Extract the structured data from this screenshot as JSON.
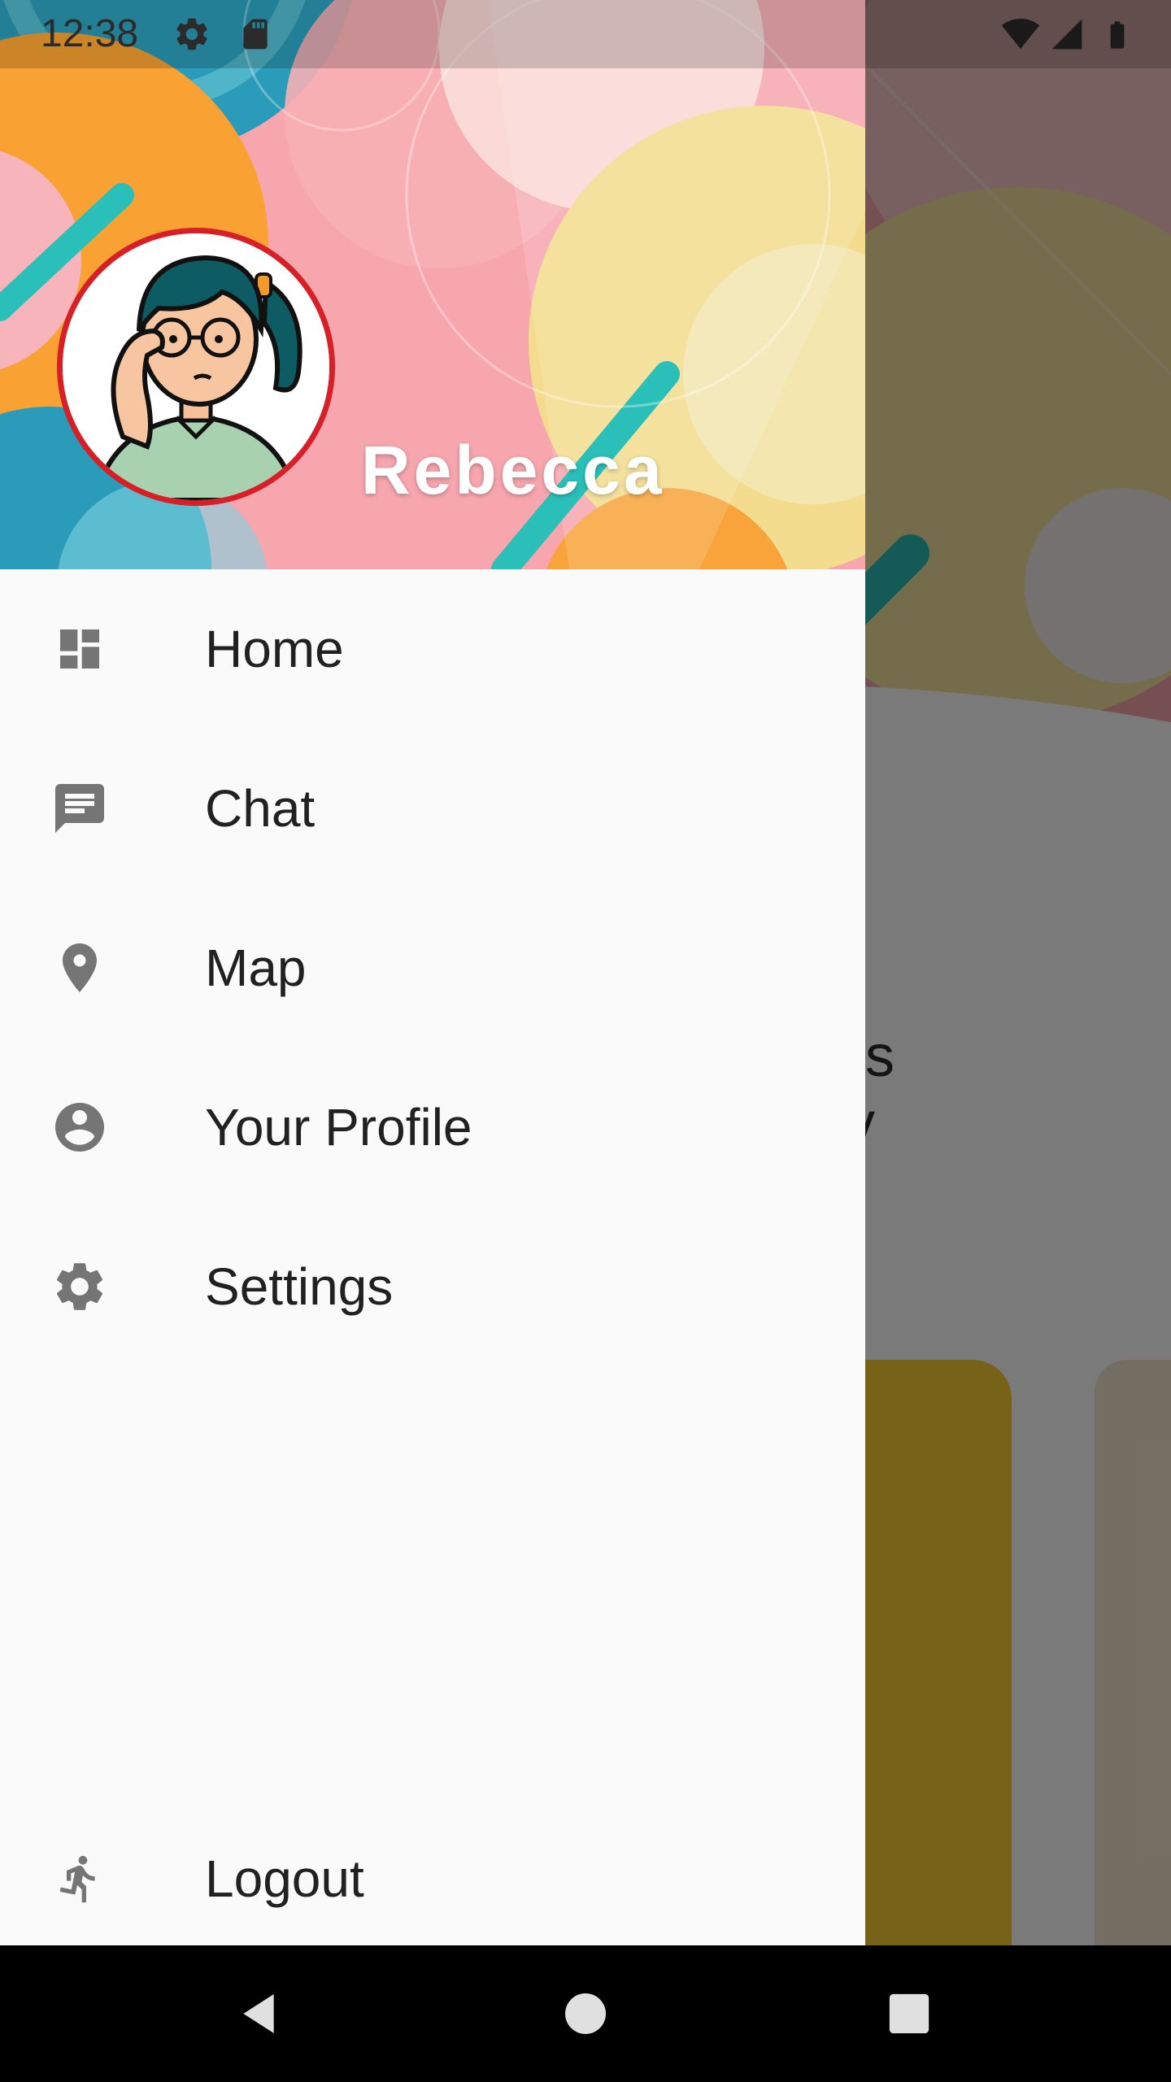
{
  "status_bar": {
    "time": "12:38",
    "icons": [
      "gear-icon",
      "sd-card-icon",
      "wifi-icon",
      "signal-icon",
      "battery-icon"
    ]
  },
  "background_app": {
    "partial_text_line1": "ers",
    "partial_text_line2": "y"
  },
  "drawer": {
    "header": {
      "username": "Rebecca",
      "avatar": "cartoon-woman-with-glasses"
    },
    "menu": [
      {
        "label": "Home",
        "icon": "dashboard-icon"
      },
      {
        "label": "Chat",
        "icon": "chat-icon"
      },
      {
        "label": "Map",
        "icon": "location-pin-icon"
      },
      {
        "label": "Your Profile",
        "icon": "account-circle-icon"
      },
      {
        "label": "Settings",
        "icon": "gear-icon"
      }
    ],
    "logout": {
      "label": "Logout",
      "icon": "running-person-icon"
    }
  },
  "nav_bar": {
    "buttons": [
      "back",
      "home",
      "recents"
    ]
  },
  "colors": {
    "drawer_bg": "#fafafa",
    "icon_gray": "#757575",
    "text_dark": "#212121",
    "avatar_border": "#d61f26",
    "accent_teal": "#2bbfb9"
  }
}
